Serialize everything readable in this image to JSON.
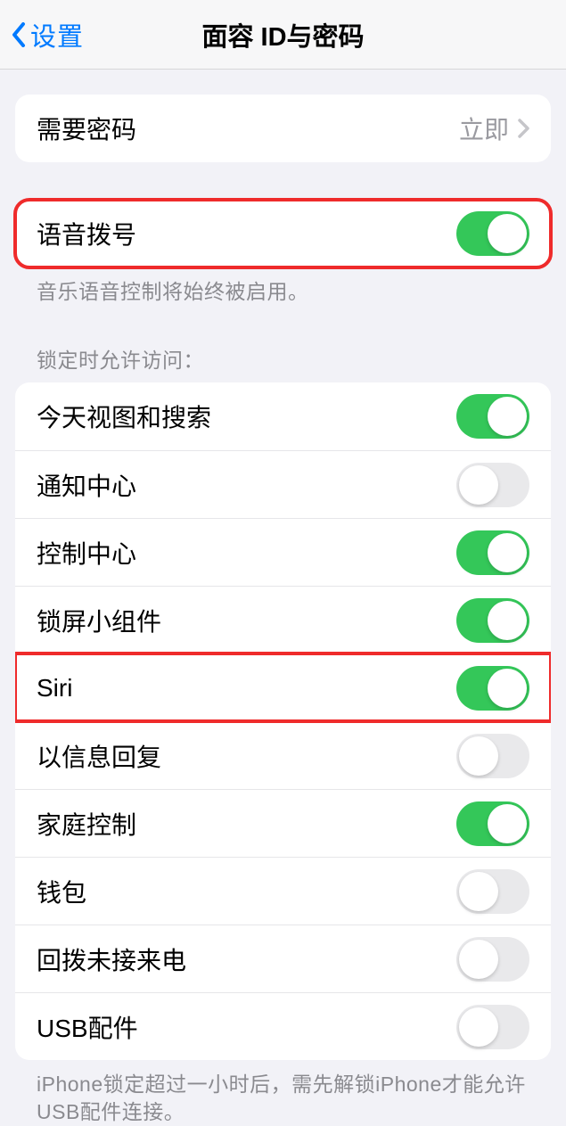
{
  "header": {
    "back": "设置",
    "title": "面容 ID与密码"
  },
  "passcode": {
    "label": "需要密码",
    "value": "立即"
  },
  "voiceDial": {
    "label": "语音拨号",
    "on": true,
    "footer": "音乐语音控制将始终被启用。"
  },
  "lockAccess": {
    "header": "锁定时允许访问：",
    "items": [
      {
        "label": "今天视图和搜索",
        "on": true
      },
      {
        "label": "通知中心",
        "on": false
      },
      {
        "label": "控制中心",
        "on": true
      },
      {
        "label": "锁屏小组件",
        "on": true
      },
      {
        "label": "Siri",
        "on": true,
        "highlight": true
      },
      {
        "label": "以信息回复",
        "on": false
      },
      {
        "label": "家庭控制",
        "on": true
      },
      {
        "label": "钱包",
        "on": false
      },
      {
        "label": "回拨未接来电",
        "on": false
      },
      {
        "label": "USB配件",
        "on": false
      }
    ],
    "footer": "iPhone锁定超过一小时后，需先解锁iPhone才能允许USB配件连接。"
  }
}
